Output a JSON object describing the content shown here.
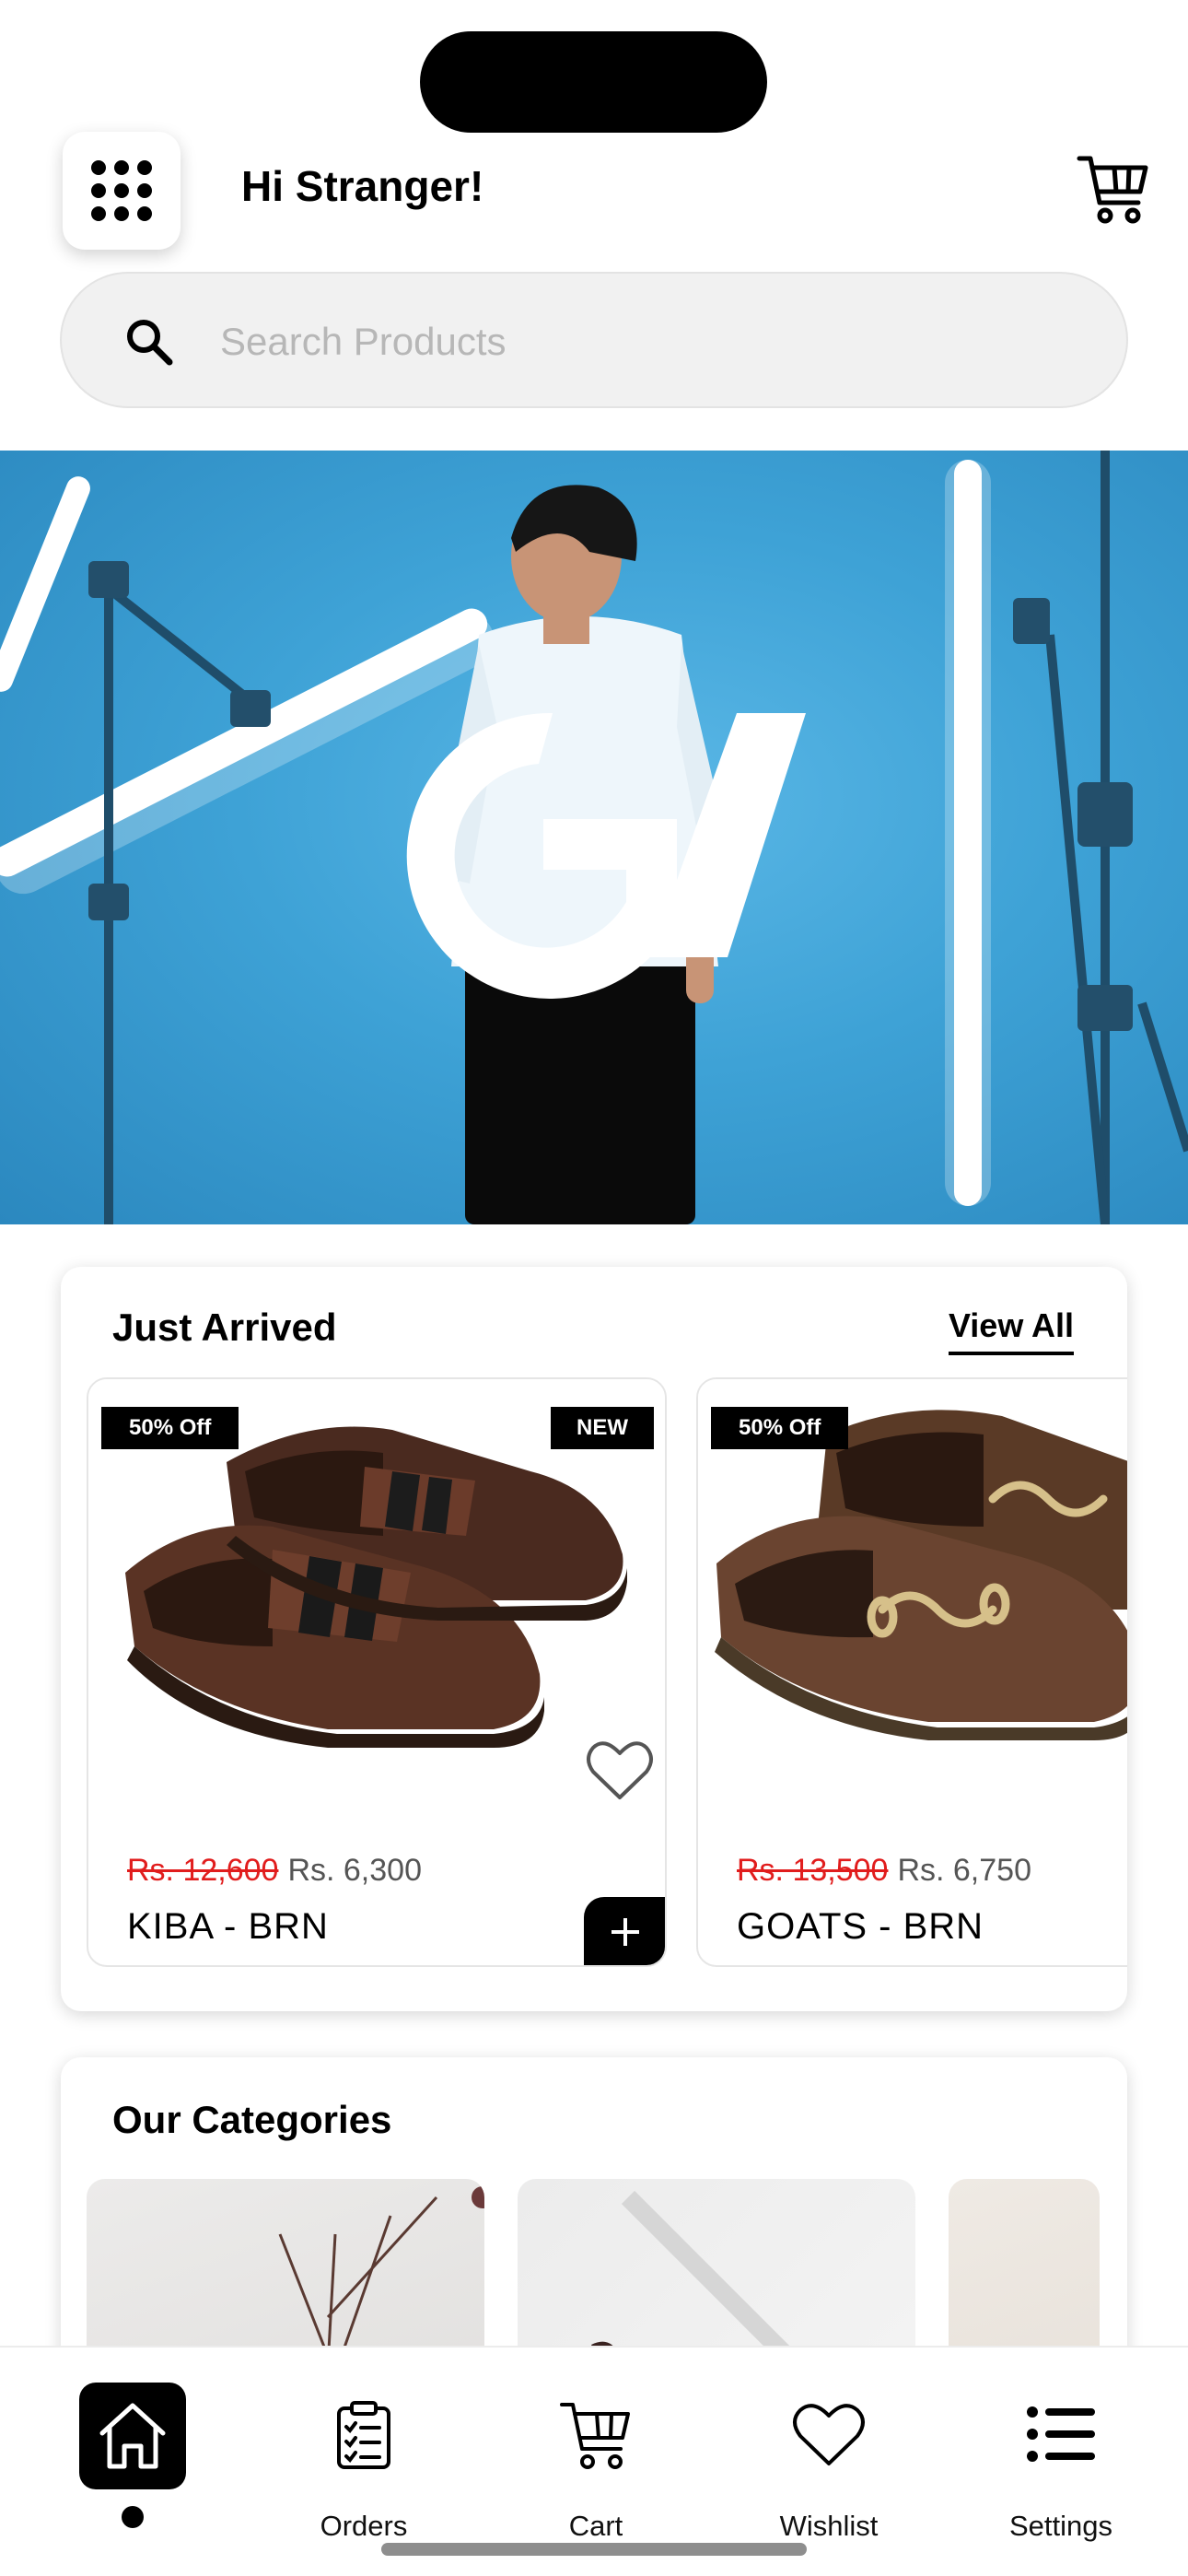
{
  "header": {
    "greeting": "Hi Stranger!",
    "menu_icon": "grid-dots-icon",
    "cart_icon": "shopping-cart-icon"
  },
  "search": {
    "placeholder": "Search Products",
    "icon": "search-icon"
  },
  "hero": {
    "logo_text": "GV"
  },
  "just_arrived": {
    "title": "Just Arrived",
    "view_all_label": "View All",
    "products": [
      {
        "discount_badge": "50% Off",
        "new_badge": "NEW",
        "old_price": "Rs. 12,600",
        "price": "Rs. 6,300",
        "name": "KIBA - BRN"
      },
      {
        "discount_badge": "50% Off",
        "old_price": "Rs. 13,500",
        "price": "Rs. 6,750",
        "name": "GOATS - BRN"
      }
    ]
  },
  "categories": {
    "title": "Our Categories"
  },
  "bottom_nav": {
    "items": [
      {
        "label": "",
        "icon": "home-icon",
        "active": true
      },
      {
        "label": "Orders",
        "icon": "clipboard-icon"
      },
      {
        "label": "Cart",
        "icon": "cart-icon"
      },
      {
        "label": "Wishlist",
        "icon": "heart-icon"
      },
      {
        "label": "Settings",
        "icon": "menu-list-icon"
      }
    ]
  },
  "colors": {
    "accent": "#000000",
    "discount_red": "#e11d1d",
    "hero_blue": "#3ea2d6"
  }
}
